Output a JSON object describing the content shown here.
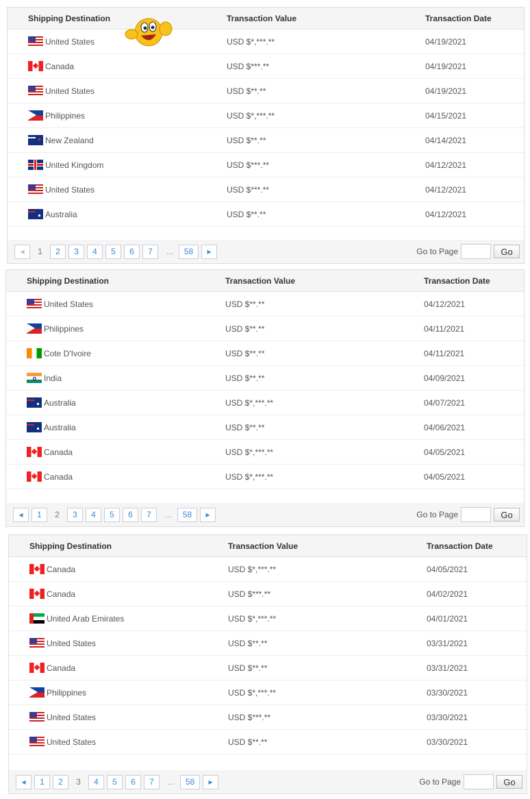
{
  "columns": [
    "Shipping Destination",
    "Transaction Value",
    "Transaction Date"
  ],
  "pager": {
    "prev": "◂",
    "next": "▸",
    "pages": [
      "1",
      "2",
      "3",
      "4",
      "5",
      "6",
      "7"
    ],
    "ellipsis": "...",
    "last": "58",
    "goto_label": "Go to Page",
    "go_label": "Go"
  },
  "panels": [
    {
      "current": "1",
      "rows": [
        [
          "us",
          "United States",
          "USD $*,***.**",
          "04/19/2021"
        ],
        [
          "ca",
          "Canada",
          "USD $***.**",
          "04/19/2021"
        ],
        [
          "us",
          "United States",
          "USD $**.**",
          "04/19/2021"
        ],
        [
          "ph",
          "Philippines",
          "USD $*,***.**",
          "04/15/2021"
        ],
        [
          "nz",
          "New Zealand",
          "USD $**.**",
          "04/14/2021"
        ],
        [
          "gb",
          "United Kingdom",
          "USD $***.**",
          "04/12/2021"
        ],
        [
          "us",
          "United States",
          "USD $***.**",
          "04/12/2021"
        ],
        [
          "au",
          "Australia",
          "USD $**.**",
          "04/12/2021"
        ]
      ]
    },
    {
      "current": "2",
      "rows": [
        [
          "us",
          "United States",
          "USD $**.**",
          "04/12/2021"
        ],
        [
          "ph",
          "Philippines",
          "USD $**.**",
          "04/11/2021"
        ],
        [
          "ci",
          "Cote D'Ivoire",
          "USD $**.**",
          "04/11/2021"
        ],
        [
          "in",
          "India",
          "USD $**.**",
          "04/09/2021"
        ],
        [
          "au",
          "Australia",
          "USD $*,***.**",
          "04/07/2021"
        ],
        [
          "au",
          "Australia",
          "USD $**.**",
          "04/06/2021"
        ],
        [
          "ca",
          "Canada",
          "USD $*,***.**",
          "04/05/2021"
        ],
        [
          "ca",
          "Canada",
          "USD $*,***.**",
          "04/05/2021"
        ]
      ]
    },
    {
      "current": "3",
      "rows": [
        [
          "ca",
          "Canada",
          "USD $*,***.**",
          "04/05/2021"
        ],
        [
          "ca",
          "Canada",
          "USD $***.**",
          "04/02/2021"
        ],
        [
          "ae",
          "United Arab Emirates",
          "USD $*,***.**",
          "04/01/2021"
        ],
        [
          "us",
          "United States",
          "USD $**.**",
          "03/31/2021"
        ],
        [
          "ca",
          "Canada",
          "USD $**.**",
          "03/31/2021"
        ],
        [
          "ph",
          "Philippines",
          "USD $*,***.**",
          "03/30/2021"
        ],
        [
          "us",
          "United States",
          "USD $***.**",
          "03/30/2021"
        ],
        [
          "us",
          "United States",
          "USD $**.**",
          "03/30/2021"
        ]
      ]
    }
  ]
}
